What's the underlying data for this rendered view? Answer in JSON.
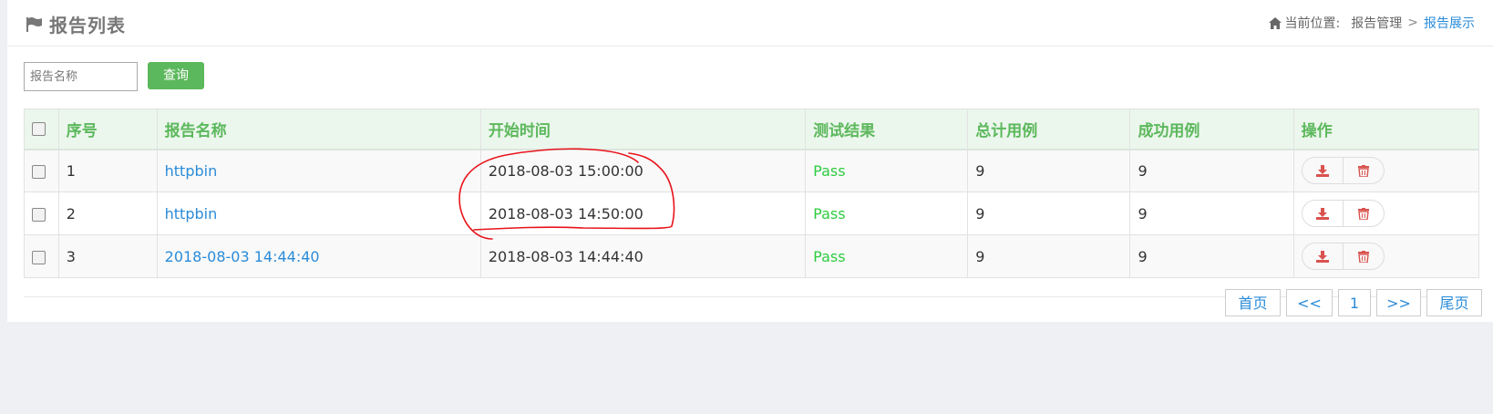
{
  "header": {
    "title": "报告列表",
    "breadcrumb": {
      "label": "当前位置:",
      "section": "报告管理",
      "separator": ">",
      "current": "报告展示"
    }
  },
  "search": {
    "placeholder": "报告名称",
    "button_label": "查询"
  },
  "table": {
    "columns": [
      "序号",
      "报告名称",
      "开始时间",
      "测试结果",
      "总计用例",
      "成功用例",
      "操作"
    ],
    "rows": [
      {
        "index": "1",
        "name": "httpbin",
        "start_time": "2018-08-03 15:00:00",
        "result": "Pass",
        "total": "9",
        "success": "9"
      },
      {
        "index": "2",
        "name": "httpbin",
        "start_time": "2018-08-03 14:50:00",
        "result": "Pass",
        "total": "9",
        "success": "9"
      },
      {
        "index": "3",
        "name": "2018-08-03 14:44:40",
        "start_time": "2018-08-03 14:44:40",
        "result": "Pass",
        "total": "9",
        "success": "9"
      }
    ]
  },
  "pagination": {
    "first": "首页",
    "prev": "<<",
    "current": "1",
    "next": ">>",
    "last": "尾页"
  },
  "colors": {
    "accent_green": "#5cb85c",
    "link_blue": "#2a8bd8",
    "pass_green": "#2ecc40",
    "danger_red": "#d9534f",
    "annotation_red": "#e8141c"
  },
  "icons": [
    "flag-icon",
    "home-icon",
    "download-icon",
    "trash-icon"
  ]
}
